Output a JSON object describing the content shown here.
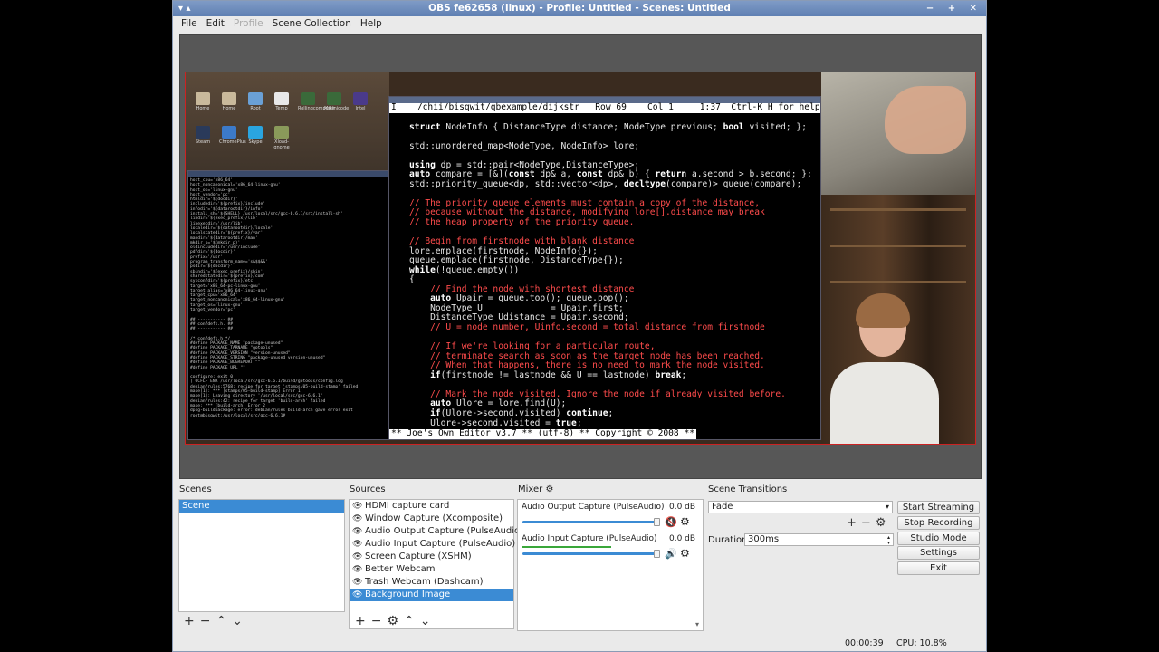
{
  "window": {
    "title": "OBS fe62658 (linux) - Profile: Untitled - Scenes: Untitled",
    "left_buttons": "▾ ▴",
    "right_buttons": "− + ✕"
  },
  "menu": [
    "File",
    "Edit",
    "Profile",
    "Scene Collection",
    "Help"
  ],
  "preview": {
    "desktop_icons": [
      "Home",
      "Home",
      "Root",
      "Temp",
      "Rollingcomputer",
      "MsUnicode",
      "Intel",
      "Steam",
      "ChromePlus",
      "Skype",
      "Xload-gnome"
    ],
    "terminal_lines": [
      "host_cpu='x86_64'",
      "host_noncanonical='x86_64-linux-gnu'",
      "host_os='linux-gnu'",
      "host_vendor='pc'",
      "htmldir='${docdir}'",
      "includedir='${prefix}/include'",
      "infodir='${datarootdir}/info'",
      "install_sh='${SHELL} /usr/local/src/gcc-6.6.1/src/install-sh'",
      "libdir='${exec_prefix}/lib'",
      "libexecdir='/usr/lib'",
      "localedir='${datarootdir}/locale'",
      "localstatedir='${prefix}/var'",
      "mandir='${datarootdir}/man'",
      "mkdir_p='$(mkdir_p)'",
      "oldincludedir='/usr/include'",
      "pdfdir='${docdir}'",
      "prefix='/usr'",
      "program_transform_name='s&$$&&'",
      "psdir='${docdir}'",
      "sbindir='${exec_prefix}/sbin'",
      "sharedstatedir='${prefix}/com'",
      "sysconfdir='${prefix}/etc'",
      "target='x86_64-pc-linux-gnu'",
      "target_alias='x86_64-linux-gnu'",
      "target_cpu='x86_64'",
      "target_noncanonical='x86_64-linux-gnu'",
      "target_os='linux-gnu'",
      "target_vendor='pc'",
      "",
      "## ----------- ##",
      "## confdefs.h. ##",
      "## ----------- ##",
      "",
      "/* confdefs.h */",
      "#define PACKAGE_NAME \"package-unused\"",
      "#define PACKAGE_TARNAME \"gotools\"",
      "#define PACKAGE_VERSION \"version-unused\"",
      "#define PACKAGE_STRING \"package-unused version-unused\"",
      "#define PACKAGE_BUGREPORT \"\"",
      "#define PACKAGE_URL \"\"",
      "",
      "configure: exit 0",
      "[ OCFLF ENR /usr/local/src/gcc-6.6.1/build/gotools/config.log",
      "debian/rules:5768: recipe for target 'stamps/05-build-stamp' failed",
      "make[1]: *** [stamps/05-build-stamp] Error 1",
      "make[1]: Leaving directory '/usr/local/src/gcc-6.6.1'",
      "debian/rules:42: recipe for target 'build-arch' failed",
      "make: *** [build-arch] Error 2",
      "dpkg-buildpackage: error: debian/rules build-arch gave error exit",
      "root@bisqwit:/usr/local/src/gcc-6.6.1# "
    ],
    "editor_status": "I    /chii/bisqwit/qbexample/dijkstr   Row 69    Col 1     1:37  Ctrl-K H for help",
    "editor_footer": "** Joe's Own Editor v3.7 ** (utf-8) ** Copyright © 2008 **"
  },
  "panels": {
    "scenes": {
      "label": "Scenes",
      "items": [
        "Scene"
      ]
    },
    "sources": {
      "label": "Sources",
      "items": [
        "HDMI capture card",
        "Window Capture (Xcomposite)",
        "Audio Output Capture (PulseAudio)",
        "Audio Input Capture (PulseAudio)",
        "Screen Capture (XSHM)",
        "Better Webcam",
        "Trash Webcam (Dashcam)",
        "Background Image"
      ],
      "selected": "Background Image"
    },
    "mixer": {
      "label": "Mixer",
      "channels": [
        {
          "name": "Audio Output Capture (PulseAudio)",
          "db": "0.0 dB",
          "muted": true,
          "level": 0.0,
          "volume": 1.0
        },
        {
          "name": "Audio Input Capture (PulseAudio)",
          "db": "0.0 dB",
          "muted": false,
          "level": 0.6,
          "volume": 1.0
        }
      ]
    },
    "transitions": {
      "label": "Scene Transitions",
      "selected": "Fade",
      "duration_label": "Duration",
      "duration_value": "300ms"
    },
    "controls": {
      "start_streaming": "Start Streaming",
      "stop_recording": "Stop Recording",
      "studio_mode": "Studio Mode",
      "settings": "Settings",
      "exit": "Exit"
    }
  },
  "status": {
    "rec_time": "00:00:39",
    "cpu": "CPU: 10.8%"
  },
  "colors": {
    "selection": "#3b8bd4",
    "titlebar": "#6a89bd",
    "mute_red": "#d22222",
    "meter_green": "#3aa73a"
  }
}
